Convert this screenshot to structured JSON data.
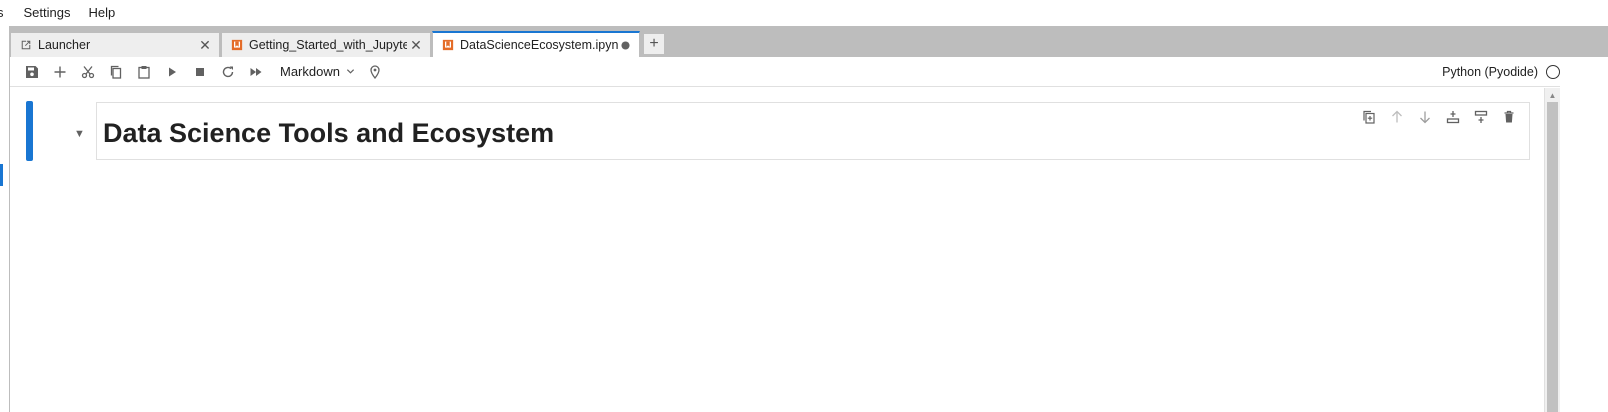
{
  "menubar": {
    "items": [
      {
        "label": "s"
      },
      {
        "label": "Settings"
      },
      {
        "label": "Help"
      }
    ]
  },
  "tabs": [
    {
      "label": "Launcher",
      "icon": "launcher-icon",
      "active": false
    },
    {
      "label": "Getting_Started_with_Jupyter",
      "icon": "notebook-icon",
      "active": false
    },
    {
      "label": "DataScienceEcosystem.ipynb",
      "icon": "notebook-icon",
      "active": true,
      "modified": true
    }
  ],
  "toolbar": {
    "cell_type": "Markdown",
    "kernel_name": "Python (Pyodide)"
  },
  "notebook": {
    "cells": [
      {
        "type": "markdown",
        "heading": "Data Science Tools and Ecosystem"
      }
    ]
  },
  "colors": {
    "accent": "#1976d2",
    "notebook_icon": "#e46c28",
    "chrome_grey": "#bdbdbd"
  }
}
